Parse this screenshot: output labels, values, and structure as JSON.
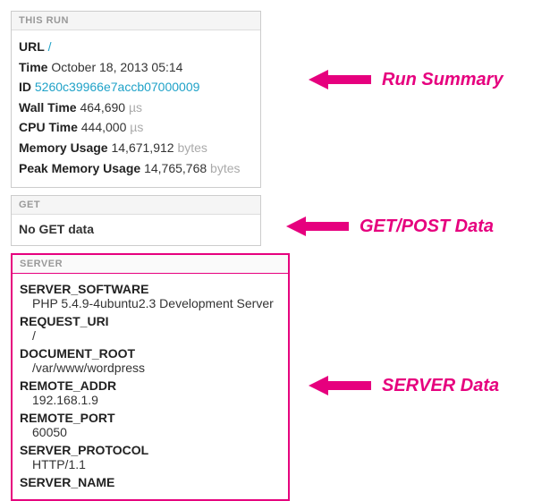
{
  "run_panel": {
    "header": "THIS RUN",
    "url_label": "URL",
    "url_value": "/",
    "time_label": "Time",
    "time_value": "October 18, 2013 05:14",
    "id_label": "ID",
    "id_value": "5260c39966e7accb07000009",
    "wall_label": "Wall Time",
    "wall_value": "464,690",
    "wall_unit": "µs",
    "cpu_label": "CPU Time",
    "cpu_value": "444,000",
    "cpu_unit": "µs",
    "mem_label": "Memory Usage",
    "mem_value": "14,671,912",
    "mem_unit": "bytes",
    "peak_label": "Peak Memory Usage",
    "peak_value": "14,765,768",
    "peak_unit": "bytes"
  },
  "get_panel": {
    "header": "GET",
    "nodata": "No GET data"
  },
  "server_panel": {
    "header": "SERVER",
    "items": [
      {
        "key": "SERVER_SOFTWARE",
        "val": "PHP 5.4.9-4ubuntu2.3 Development Server"
      },
      {
        "key": "REQUEST_URI",
        "val": "/"
      },
      {
        "key": "DOCUMENT_ROOT",
        "val": "/var/www/wordpress"
      },
      {
        "key": "REMOTE_ADDR",
        "val": "192.168.1.9"
      },
      {
        "key": "REMOTE_PORT",
        "val": "60050"
      },
      {
        "key": "SERVER_PROTOCOL",
        "val": "HTTP/1.1"
      },
      {
        "key": "SERVER_NAME",
        "val": ""
      }
    ]
  },
  "annotations": {
    "run": "Run Summary",
    "get": "GET/POST Data",
    "server": "SERVER Data"
  },
  "colors": {
    "pink": "#e6007e",
    "link": "#1fa2c8"
  }
}
